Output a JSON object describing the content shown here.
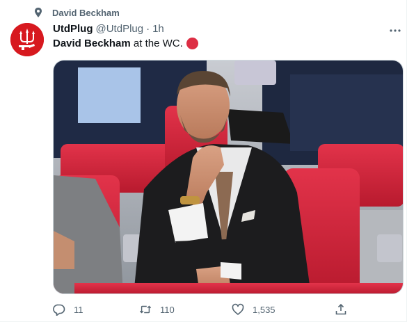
{
  "social_context": {
    "label": "David Beckham",
    "icon": "pin-icon"
  },
  "author": {
    "display_name": "UtdPlug",
    "handle": "@UtdPlug",
    "separator": "·",
    "time": "1h",
    "avatar_color": "#d7191f"
  },
  "tweet": {
    "mention": "David Beckham",
    "text": " at the WC."
  },
  "media": {
    "description_icon": "photo"
  },
  "actions": {
    "reply_count": "11",
    "retweet_count": "110",
    "like_count": "1,535"
  },
  "colors": {
    "secondary_text": "#536471",
    "red_circle": "#dd2e44",
    "seat_red": "#d8253a"
  }
}
